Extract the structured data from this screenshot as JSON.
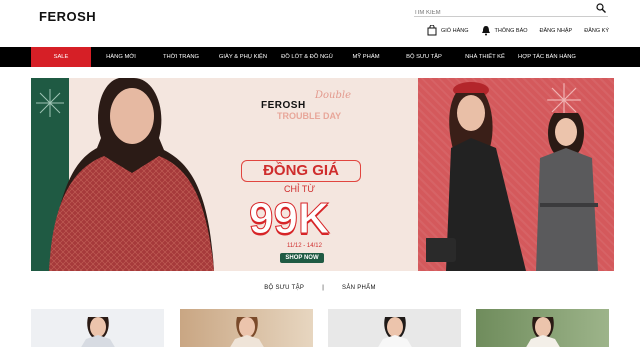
{
  "header": {
    "logo": "FEROSH",
    "search_placeholder": "TÌM KIẾM",
    "utilities": [
      {
        "label": "GIỎ HÀNG",
        "icon": "bag-icon"
      },
      {
        "label": "THÔNG BÁO",
        "icon": "bell-icon"
      },
      {
        "label": "ĐĂNG NHẬP"
      },
      {
        "label": "ĐĂNG KÝ"
      }
    ]
  },
  "nav": {
    "items": [
      {
        "label": "SALE"
      },
      {
        "label": "HÀNG MỚI"
      },
      {
        "label": "THỜI TRANG"
      },
      {
        "label": "GIÀY & PHỤ KIỆN"
      },
      {
        "label": "ĐỒ LÓT & ĐỒ NGỦ"
      },
      {
        "label": "MỸ PHẨM"
      },
      {
        "label": "BỘ SƯU TẬP"
      },
      {
        "label": "NHÀ THIẾT KẾ"
      },
      {
        "label": "HỢP TÁC BÁN HÀNG"
      }
    ],
    "sale_color": "#d61f26"
  },
  "banner": {
    "brand": "FEROSH",
    "script": "Double",
    "subtitle": "TROUBLE DAY",
    "headline": "ĐỒNG GIÁ",
    "from_text": "CHỈ TỪ",
    "price": "99K",
    "dates": "11/12 - 14/12",
    "cta": "SHOP NOW",
    "colors": {
      "green": "#1f5a43",
      "red": "#d4595c",
      "accent": "#d72528"
    }
  },
  "sections": {
    "tabs": [
      {
        "label": "BỘ SƯU TẬP"
      },
      {
        "label": "SẢN PHẨM"
      }
    ],
    "separator": "|"
  }
}
